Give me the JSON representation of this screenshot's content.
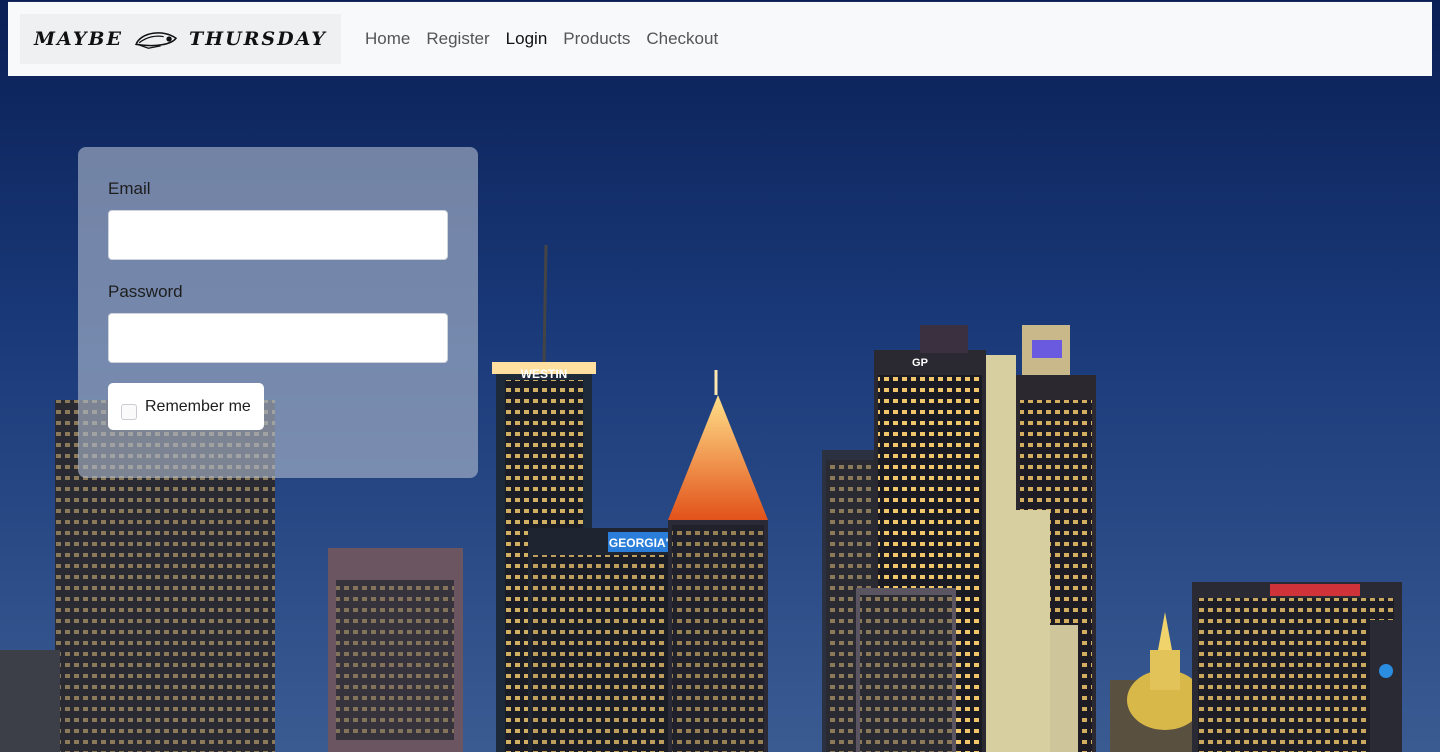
{
  "brand": {
    "name_left": "MAYBE",
    "name_right": "THURSDAY",
    "logo_icon": "cap-icon"
  },
  "nav": {
    "links": [
      "Home",
      "Register",
      "Login",
      "Products",
      "Checkout"
    ],
    "active": "Login"
  },
  "form": {
    "email_label": "Email",
    "email_value": "",
    "password_label": "Password",
    "password_value": "",
    "remember_label": "Remember me",
    "remember_checked": false
  },
  "background": {
    "sky_top": "#0c2660",
    "sky_bottom": "#2c4f8c",
    "signs": [
      "WESTIN",
      "GEORGIA'S OWN",
      "GP"
    ]
  },
  "colors": {
    "navbar_bg": "#f8f9fa",
    "card_bg": "rgba(175,185,205,0.62)"
  }
}
